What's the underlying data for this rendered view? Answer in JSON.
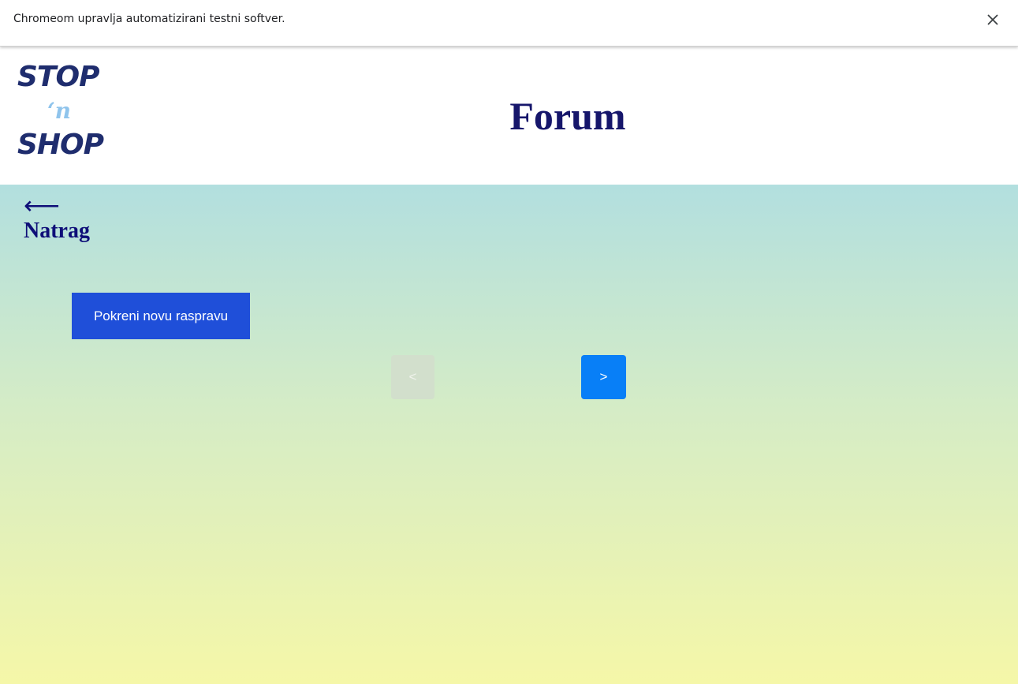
{
  "infobar": {
    "message": "Chromeom upravlja automatizirani testni softver.",
    "close_icon": "close-icon"
  },
  "header": {
    "logo": {
      "line1": "STOP",
      "line2": "‘n",
      "line3": "SHOP",
      "color_primary": "#1f2d6e",
      "color_accent": "#8fc4ec"
    },
    "title": "Forum",
    "title_color": "#16166b"
  },
  "main": {
    "background_top": "#b2dfdf",
    "background_bottom": "#f5f7a8",
    "back": {
      "arrow": "⟵",
      "label": "Natrag"
    },
    "new_thread_button": "Pokreni novu raspravu",
    "pagination": {
      "prev_label": "<",
      "prev_disabled": true,
      "next_label": ">",
      "next_disabled": false
    },
    "colors": {
      "primary_button": "#1f4fd9",
      "next_button": "#087ff7",
      "disabled_button": "#d2dfcc"
    }
  }
}
